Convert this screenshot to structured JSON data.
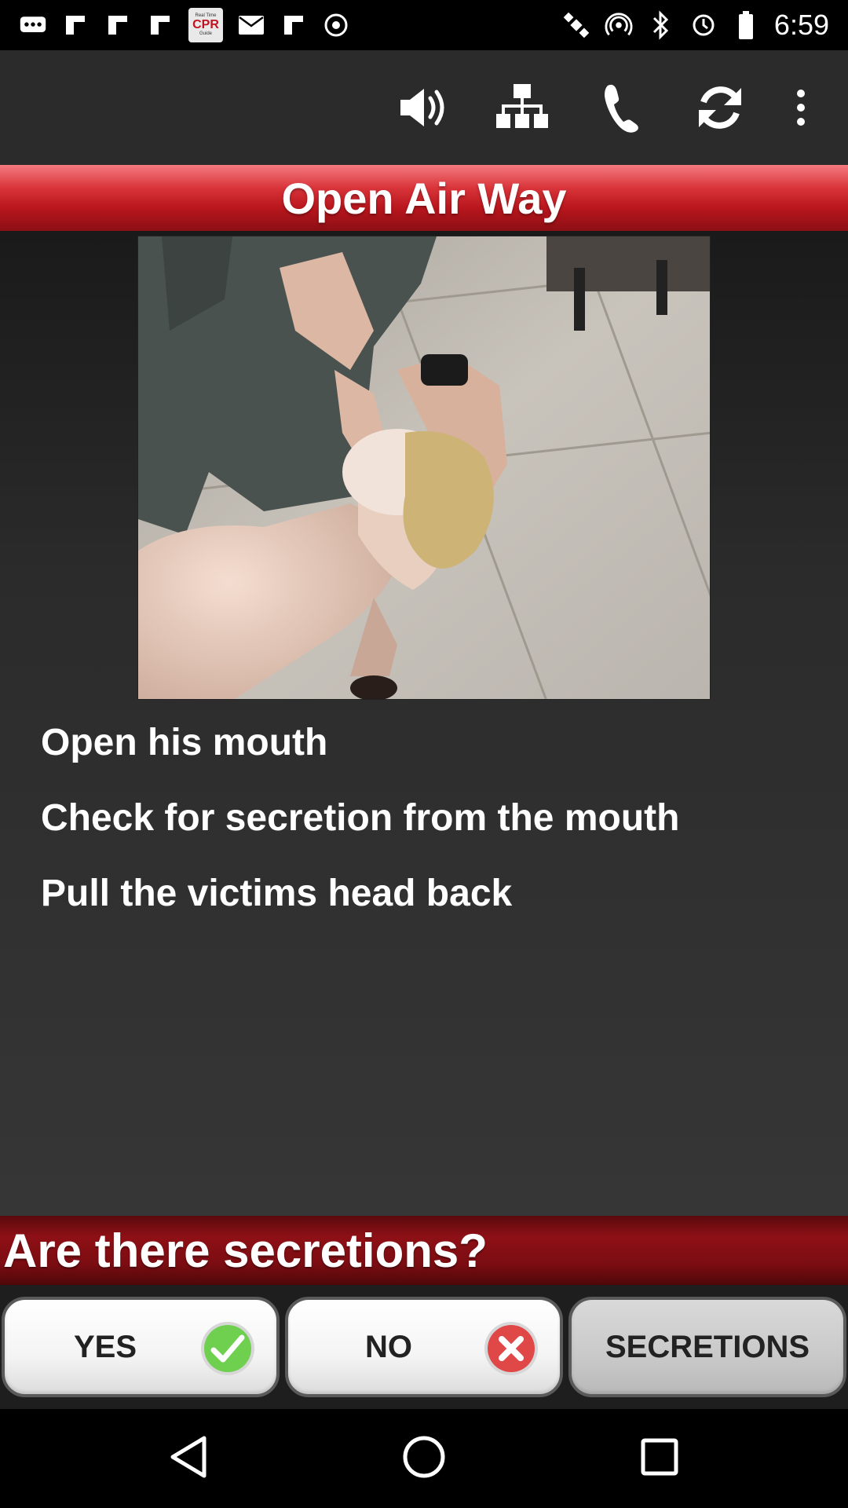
{
  "status_bar": {
    "time": "6:59",
    "notification_app": {
      "line1": "Real Time",
      "line2": "CPR",
      "line3": "Guide"
    },
    "icons": [
      "chat-icon",
      "flipboard-icon",
      "flipboard-icon",
      "flipboard-icon",
      "cpr-app-icon",
      "email-icon",
      "flipboard-icon",
      "target-icon",
      "satellite-icon",
      "hotspot-icon",
      "bluetooth-icon",
      "sync-icon",
      "battery-icon"
    ]
  },
  "toolbar": {
    "icons": [
      "speaker-icon",
      "sitemap-icon",
      "phone-icon",
      "refresh-icon",
      "more-vert-icon"
    ]
  },
  "header": {
    "title": "Open Air Way"
  },
  "instructions": [
    "Open his mouth",
    "Check for secretion from the mouth",
    "Pull the victims head back"
  ],
  "question": {
    "text": "Are there secretions?"
  },
  "answers": {
    "yes": "YES",
    "no": "NO",
    "secretions": "SECRETIONS"
  },
  "colors": {
    "title_red": "#c1121f",
    "question_red": "#8e1016",
    "background": "#333333",
    "check_green": "#4caf50",
    "cross_red": "#e23b3b"
  }
}
